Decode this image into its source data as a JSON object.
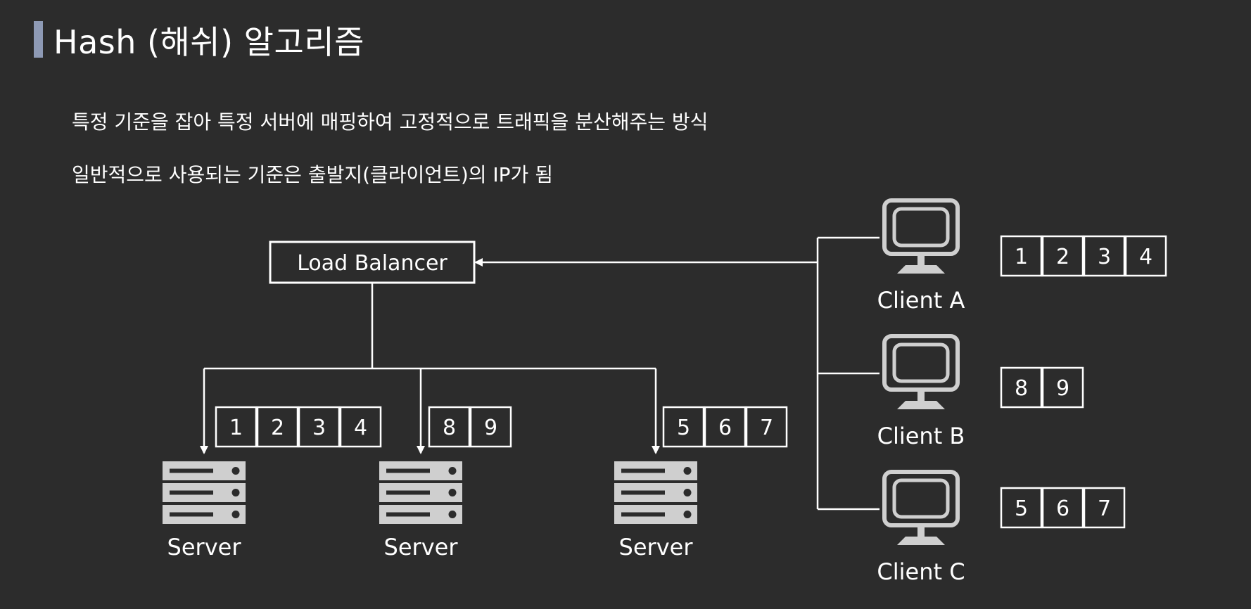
{
  "title": "Hash (해쉬) 알고리즘",
  "description": [
    "특정 기준을 잡아 특정 서버에 매핑하여 고정적으로 트래픽을 분산해주는 방식",
    "일반적으로 사용되는 기준은 출발지(클라이언트)의 IP가 됨"
  ],
  "load_balancer": {
    "label": "Load Balancer"
  },
  "servers": [
    {
      "label": "Server",
      "requests": [
        "1",
        "2",
        "3",
        "4"
      ]
    },
    {
      "label": "Server",
      "requests": [
        "8",
        "9"
      ]
    },
    {
      "label": "Server",
      "requests": [
        "5",
        "6",
        "7"
      ]
    }
  ],
  "clients": [
    {
      "label": "Client A",
      "requests": [
        "1",
        "2",
        "3",
        "4"
      ]
    },
    {
      "label": "Client B",
      "requests": [
        "8",
        "9"
      ]
    },
    {
      "label": "Client C",
      "requests": [
        "5",
        "6",
        "7"
      ]
    }
  ],
  "colors": {
    "background": "#2c2c2c",
    "accent": "#8e9ab5",
    "line": "#ffffff",
    "icon": "#cfcfcf"
  }
}
